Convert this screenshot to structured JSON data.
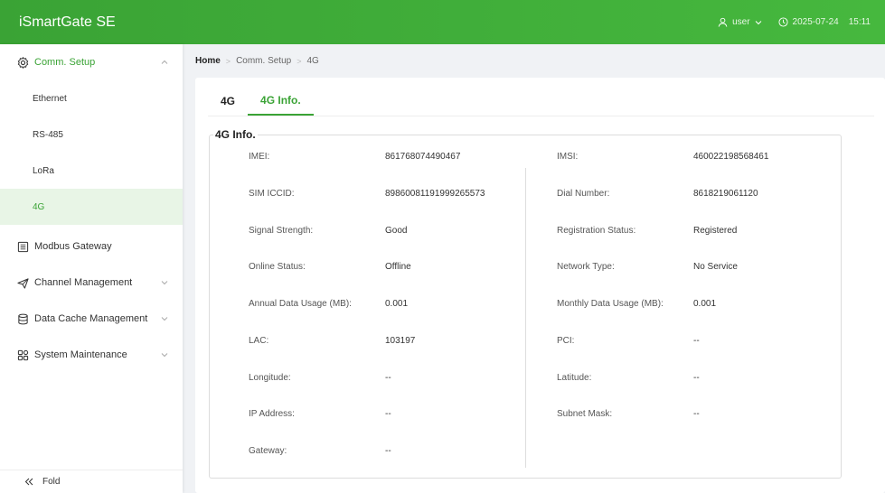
{
  "app": {
    "title": "iSmartGate SE"
  },
  "header": {
    "user": "user",
    "date": "2025-07-24",
    "time": "15:11"
  },
  "sidebar": {
    "groups": [
      {
        "label": "Comm. Setup",
        "icon": "gear-icon",
        "expanded": true,
        "items": [
          {
            "label": "Ethernet"
          },
          {
            "label": "RS-485"
          },
          {
            "label": "LoRa"
          },
          {
            "label": "4G"
          }
        ]
      },
      {
        "label": "Modbus Gateway",
        "icon": "document-icon"
      },
      {
        "label": "Channel Management",
        "icon": "plane-icon"
      },
      {
        "label": "Data Cache Management",
        "icon": "database-icon"
      },
      {
        "label": "System Maintenance",
        "icon": "grid-icon"
      }
    ],
    "fold_label": "Fold"
  },
  "breadcrumb": {
    "home": "Home",
    "level1": "Comm. Setup",
    "level2": "4G"
  },
  "tabs": [
    {
      "label": "4G"
    },
    {
      "label": "4G Info."
    }
  ],
  "info": {
    "legend": "4G Info.",
    "left": [
      {
        "label": "IMEI:",
        "value": "861768074490467"
      },
      {
        "label": "SIM ICCID:",
        "value": "89860081191999265573"
      },
      {
        "label": "Signal Strength:",
        "value": "Good"
      },
      {
        "label": "Online Status:",
        "value": "Offline"
      },
      {
        "label": "Annual Data Usage (MB):",
        "value": "0.001"
      },
      {
        "label": "LAC:",
        "value": "103197"
      },
      {
        "label": "Longitude:",
        "value": "--"
      },
      {
        "label": "IP Address:",
        "value": "--"
      },
      {
        "label": "Gateway:",
        "value": "--"
      }
    ],
    "right": [
      {
        "label": "IMSI:",
        "value": "460022198568461"
      },
      {
        "label": "Dial Number:",
        "value": "8618219061120"
      },
      {
        "label": "Registration Status:",
        "value": "Registered"
      },
      {
        "label": "Network Type:",
        "value": "No Service"
      },
      {
        "label": "Monthly Data Usage (MB):",
        "value": "0.001"
      },
      {
        "label": "PCI:",
        "value": "--"
      },
      {
        "label": "Latitude:",
        "value": "--"
      },
      {
        "label": "Subnet Mask:",
        "value": "--"
      }
    ]
  },
  "colors": {
    "accent": "#3aa335",
    "active_bg": "#e8f5e6"
  }
}
